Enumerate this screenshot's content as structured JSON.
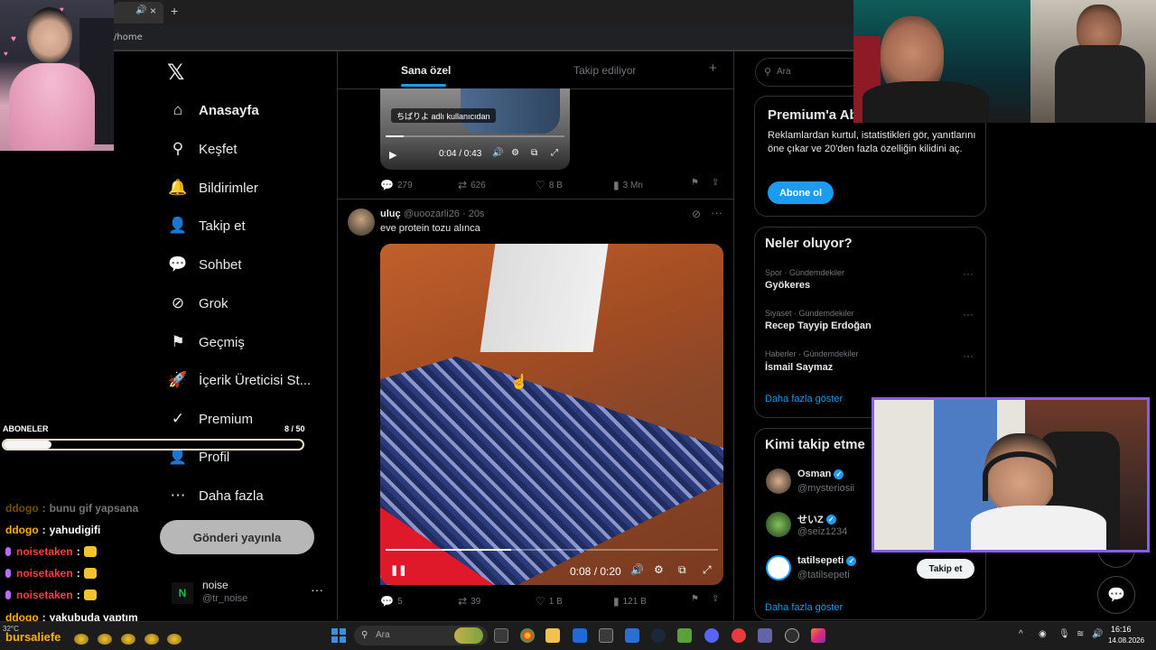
{
  "browser": {
    "address": "/home",
    "new_tab": "+",
    "tab_close": "×",
    "tab_mute": "🔊"
  },
  "nav": {
    "logo": "𝕏",
    "items": [
      {
        "label": "Anasayfa",
        "icon": "home-icon",
        "glyph": "⌂"
      },
      {
        "label": "Keşfet",
        "icon": "search-icon",
        "glyph": "⚲"
      },
      {
        "label": "Bildirimler",
        "icon": "bell-icon",
        "glyph": "🔔"
      },
      {
        "label": "Takip et",
        "icon": "person-add-icon",
        "glyph": "👤"
      },
      {
        "label": "Sohbet",
        "icon": "chat-bubble-icon",
        "glyph": "💬"
      },
      {
        "label": "Grok",
        "icon": "grok-icon",
        "glyph": "⊘"
      },
      {
        "label": "Geçmiş",
        "icon": "bookmark-icon",
        "glyph": "⚑"
      },
      {
        "label": "İçerik Üreticisi St...",
        "icon": "rocket-icon",
        "glyph": "🚀"
      },
      {
        "label": "Premium",
        "icon": "premium-icon",
        "glyph": "✓"
      },
      {
        "label": "Profil",
        "icon": "profile-icon",
        "glyph": "👤"
      },
      {
        "label": "Daha fazla",
        "icon": "more-circle-icon",
        "glyph": "⋯"
      }
    ],
    "post_button": "Gönderi yayınla",
    "account": {
      "name": "noise",
      "handle": "@tr_noise",
      "avatar_letter": "N",
      "more": "···"
    }
  },
  "feed": {
    "tabs": {
      "for_you": "Sana özel",
      "following": "Takip ediliyor",
      "plus": "+"
    },
    "tweet1": {
      "video_tag": "ちばりよ adlı kullanıcıdan",
      "time": "0:04 / 0:43",
      "stats": {
        "replies": "279",
        "reposts": "626",
        "likes": "8 B",
        "views": "3 Mn"
      }
    },
    "tweet2": {
      "name": "uluç",
      "handle": "@uoozarli26 · 20s",
      "text": "eve protein tozu alınca",
      "time": "0:08 / 0:20",
      "stats": {
        "replies": "5",
        "reposts": "39",
        "likes": "1 B",
        "views": "121 B"
      }
    }
  },
  "right": {
    "search_placeholder": "Ara",
    "premium": {
      "title": "Premium'a Ab",
      "desc": "Reklamlardan kurtul, istatistikleri gör, yanıtlarını öne çıkar ve 20'den fazla özelliğin kilidini aç.",
      "button": "Abone ol"
    },
    "trends": {
      "title": "Neler oluyor?",
      "items": [
        {
          "cat": "Spor · Gündemdekiler",
          "name": "Gyökeres"
        },
        {
          "cat": "Siyaset · Gündemdekiler",
          "name": "Recep Tayyip Erdoğan"
        },
        {
          "cat": "Haberler · Gündemdekiler",
          "name": "İsmail Saymaz"
        }
      ],
      "more": "Daha fazla göster"
    },
    "follow": {
      "title": "Kimi takip etme",
      "items": [
        {
          "name": "Osman",
          "handle": "@mysteriosii"
        },
        {
          "name": "せいZ",
          "handle": "@seiz1234"
        },
        {
          "name": "tatilsepeti",
          "handle": "@tatilsepeti"
        }
      ],
      "follow_button": "Takip et",
      "more": "Daha fazla göster"
    }
  },
  "overlay": {
    "subs_label": "ABONELER",
    "subs_count": "8 / 50",
    "subs_progress": 0.16,
    "chat": [
      {
        "user": "ddogo",
        "msg": "bunu gif yapsana",
        "faded": true,
        "style": "orange"
      },
      {
        "user": "ddogo",
        "msg": "yahudigifi",
        "faded": false,
        "style": "orange"
      },
      {
        "user": "noisetaken",
        "msg": "",
        "faded": false,
        "style": "red"
      },
      {
        "user": "noisetaken",
        "msg": "",
        "faded": false,
        "style": "red"
      },
      {
        "user": "noisetaken",
        "msg": "",
        "faded": false,
        "style": "red"
      },
      {
        "user": "ddogo",
        "msg": "yakubuda yaptım",
        "faded": false,
        "style": "orange"
      }
    ],
    "bottom_user": "bursaliefe",
    "weather": "32°C"
  },
  "taskbar": {
    "search": "Ara",
    "time": "16:16",
    "date": "14.08.2026"
  },
  "colors": {
    "accent": "#1d9bf0",
    "chat_orange": "#ffb000",
    "chat_red": "#ff3d3d",
    "cam_border": "#8a5cf6"
  }
}
